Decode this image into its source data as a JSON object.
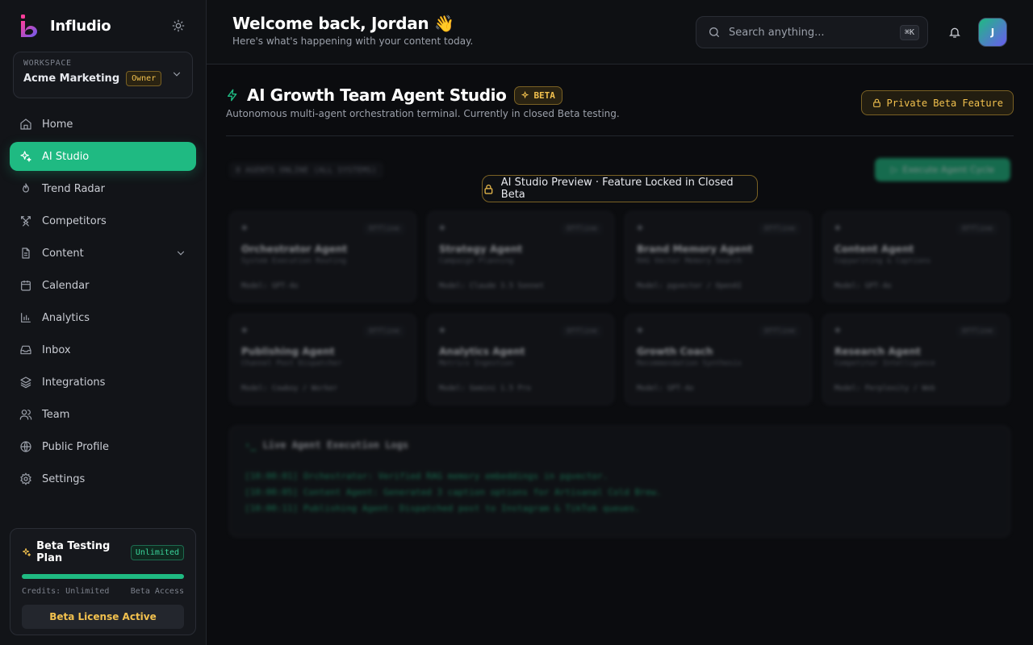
{
  "app": {
    "name": "Infludio"
  },
  "workspace": {
    "label": "WORKSPACE",
    "name": "Acme Marketing",
    "role": "Owner"
  },
  "sidebar": {
    "items": [
      {
        "label": "Home",
        "icon": "home-icon"
      },
      {
        "label": "AI Studio",
        "icon": "sparkles-icon",
        "active": true
      },
      {
        "label": "Trend Radar",
        "icon": "flame-icon"
      },
      {
        "label": "Competitors",
        "icon": "swords-icon"
      },
      {
        "label": "Content",
        "icon": "file-icon"
      },
      {
        "label": "Calendar",
        "icon": "calendar-icon"
      },
      {
        "label": "Analytics",
        "icon": "bar-chart-icon"
      },
      {
        "label": "Inbox",
        "icon": "inbox-icon"
      },
      {
        "label": "Integrations",
        "icon": "layers-icon"
      },
      {
        "label": "Team",
        "icon": "users-icon"
      },
      {
        "label": "Public Profile",
        "icon": "globe-icon"
      },
      {
        "label": "Settings",
        "icon": "gear-icon"
      }
    ]
  },
  "plan": {
    "title": "Beta Testing Plan",
    "badge": "Unlimited",
    "progress": 1.0,
    "credits": "Credits: Unlimited",
    "access": "Beta Access",
    "button": "Beta License Active"
  },
  "header": {
    "title": "Welcome back, Jordan 👋",
    "subtitle": "Here's what's happening with your content today.",
    "search_placeholder": "Search anything...",
    "shortcut": "⌘K",
    "avatar_initial": "J"
  },
  "studio": {
    "title": "AI Growth Team Agent Studio",
    "badge": "BETA",
    "subtitle": "Autonomous multi-agent orchestration terminal. Currently in closed Beta testing.",
    "private_button": "Private Beta Feature",
    "status": "8 AGENTS ONLINE (ALL SYSTEMS)",
    "execute_button": "Execute Agent Cycle",
    "lock_banner": "AI Studio Preview · Feature Locked in Closed Beta",
    "agents": [
      {
        "name": "Orchestrator Agent",
        "role": "System Execution Routing",
        "model": "Model: GPT-4o",
        "status": "Offline"
      },
      {
        "name": "Strategy Agent",
        "role": "Campaign Planning",
        "model": "Model: Claude 3.5 Sonnet",
        "status": "Offline"
      },
      {
        "name": "Brand Memory Agent",
        "role": "RAG Vector Memory Search",
        "model": "Model: pgvector / OpenAI",
        "status": "Offline"
      },
      {
        "name": "Content Agent",
        "role": "Copywriting & Captions",
        "model": "Model: GPT-4o",
        "status": "Offline"
      },
      {
        "name": "Publishing Agent",
        "role": "Channel Post Dispatcher",
        "model": "Model: Cowboy / Worker",
        "status": "Offline"
      },
      {
        "name": "Analytics Agent",
        "role": "Metrics Ingestion",
        "model": "Model: Gemini 1.5 Pro",
        "status": "Offline"
      },
      {
        "name": "Growth Coach",
        "role": "Recommendation Synthesis",
        "model": "Model: GPT-4o",
        "status": "Offline"
      },
      {
        "name": "Research Agent",
        "role": "Competitor Intelligence",
        "model": "Model: Perplexity / Web",
        "status": "Offline"
      }
    ],
    "logs": {
      "title": "Live Agent Execution Logs",
      "lines": [
        "[10:00:01] Orchestrator: Verified RAG memory embeddings in pgvector.",
        "[10:00:05] Content Agent: Generated 3 caption options for Artisanal Cold Brew.",
        "[10:00:11] Publishing Agent: Dispatched post to Instagram & TikTok queues."
      ]
    }
  },
  "colors": {
    "accent": "#1fba82",
    "warning": "#f2c14e",
    "background": "#0b0c0f"
  }
}
